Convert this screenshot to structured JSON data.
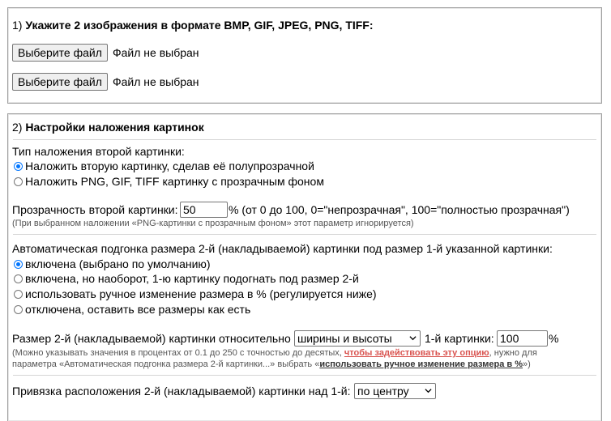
{
  "section1": {
    "heading_num": "1) ",
    "heading_text": "Укажите 2 изображения в формате BMP, GIF, JPEG, PNG, TIFF:",
    "file1": {
      "button": "Выберите файл",
      "status": "Файл не выбран"
    },
    "file2": {
      "button": "Выберите файл",
      "status": "Файл не выбран"
    }
  },
  "section2": {
    "heading_num": "2) ",
    "heading_text": "Настройки наложения картинок",
    "overlay_type": {
      "label": "Тип наложения второй картинки:",
      "options": [
        {
          "label": "Наложить вторую картинку, сделав её полупрозрачной",
          "checked": true
        },
        {
          "label": "Наложить PNG, GIF, TIFF картинку с прозрачным фоном",
          "checked": false
        }
      ]
    },
    "transparency": {
      "label": "Прозрачность второй картинки:",
      "value": "50",
      "suffix": "% (от 0 до 100, 0=\"непрозрачная\", 100=\"полностью прозрачная\")",
      "note": "(При выбранном наложении «PNG-картинки с прозрачным фоном» этот параметр игнорируется)"
    },
    "auto_fit": {
      "label": "Автоматическая подгонка размера 2-й (накладываемой) картинки под размер 1-й указанной картинки:",
      "options": [
        {
          "label": "включена (выбрано по умолчанию)",
          "checked": true
        },
        {
          "label": "включена, но наоборот, 1-ю картинку подогнать под размер 2-й",
          "checked": false
        },
        {
          "label": "использовать ручное изменение размера в % (регулируется ниже)",
          "checked": false
        },
        {
          "label": "отключена, оставить все размеры как есть",
          "checked": false
        }
      ]
    },
    "size": {
      "label": "Размер 2-й (накладываемой) картинки относительно",
      "select_value": "ширины и высоты",
      "label2": "1-й картинки:",
      "value": "100",
      "suffix": "%",
      "note_part1": "(Можно указывать значения в процентах от 0.1 до 250 с точностью до десятых, ",
      "note_link": "чтобы задействовать эту опцию",
      "note_part2": ", нужно для",
      "note_line2_part1": "параметра «Автоматическая подгонка размера 2-й картинки...» выбрать «",
      "note_line2_link": "использовать ручное изменение размера в %",
      "note_line2_part2": "»)"
    },
    "position": {
      "label": "Привязка расположения 2-й (накладываемой) картинки над 1-й:",
      "select_value": "по центру"
    }
  }
}
